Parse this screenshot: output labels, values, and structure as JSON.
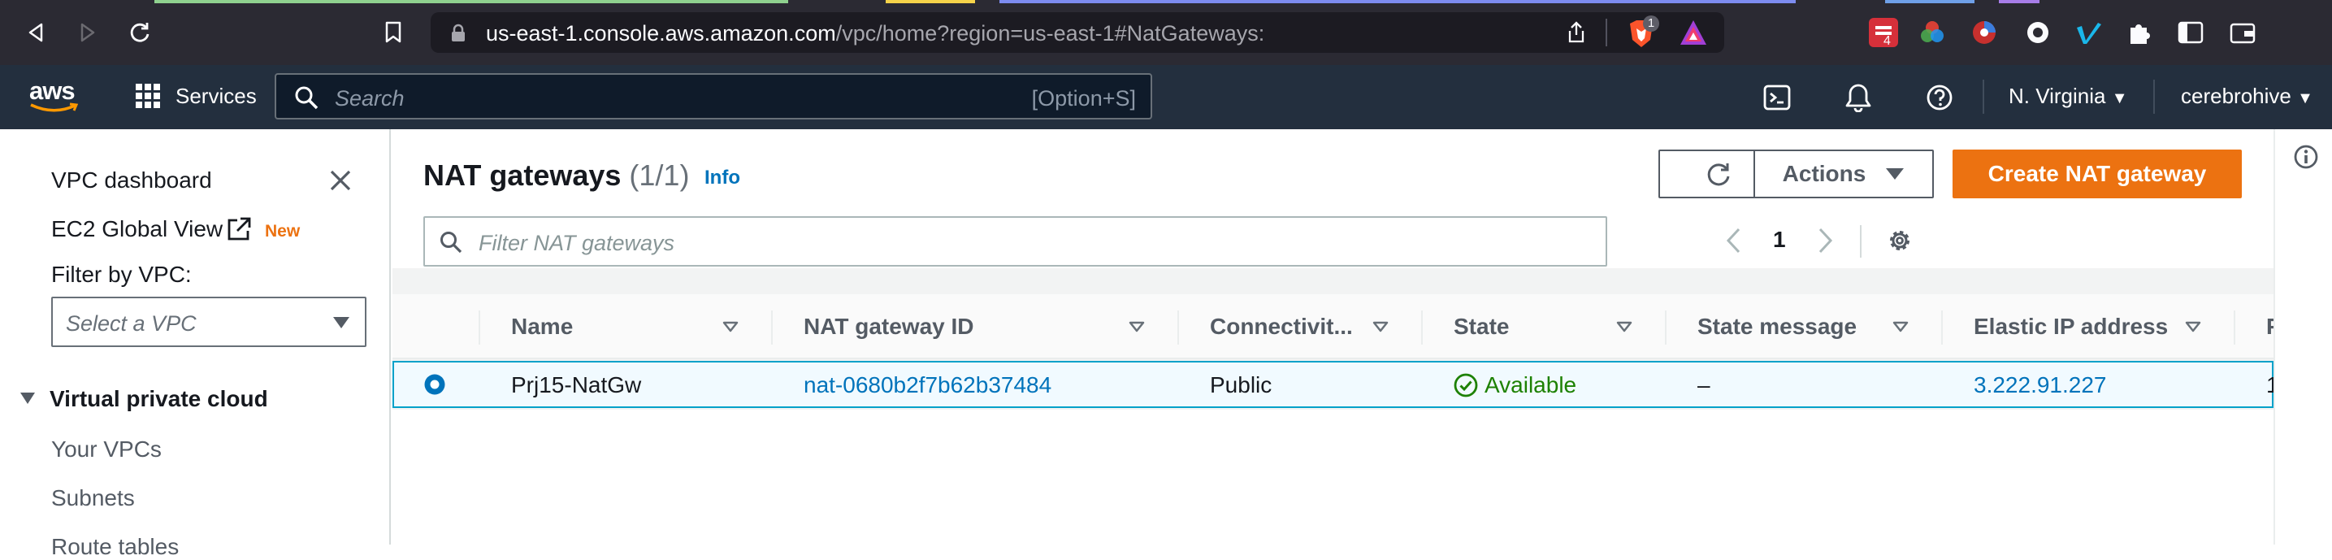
{
  "browser": {
    "url_host": "us-east-1.console.aws.amazon.com",
    "url_path": "/vpc/home?region=us-east-1#NatGateways:",
    "brave_badge": "1",
    "ext_badge": "4"
  },
  "aws_nav": {
    "logo": "aws",
    "services_label": "Services",
    "search_placeholder": "Search",
    "search_shortcut": "[Option+S]",
    "region": "N. Virginia",
    "account": "cerebrohive"
  },
  "sidebar": {
    "dashboard": "VPC dashboard",
    "global_view": "EC2 Global View",
    "new_badge": "New",
    "filter_label": "Filter by VPC:",
    "select_placeholder": "Select a VPC",
    "section": "Virtual private cloud",
    "items": [
      "Your VPCs",
      "Subnets",
      "Route tables"
    ]
  },
  "main": {
    "title": "NAT gateways",
    "count": "(1/1)",
    "info": "Info",
    "actions_label": "Actions",
    "create_label": "Create NAT gateway",
    "filter_placeholder": "Filter NAT gateways",
    "page_number": "1"
  },
  "table": {
    "columns": [
      "Name",
      "NAT gateway ID",
      "Connectivit...",
      "State",
      "State message",
      "Elastic IP address",
      "P"
    ],
    "rows": [
      {
        "name": "Prj15-NatGw",
        "id": "nat-0680b2f7b62b37484",
        "connectivity": "Public",
        "state": "Available",
        "state_message": "–",
        "elastic_ip": "3.222.91.227",
        "next_col": "1"
      }
    ]
  },
  "colors": {
    "aws_nav_bg": "#232f3e",
    "primary_orange": "#ec7211",
    "link_blue": "#0073bb",
    "success_green": "#1d8102",
    "selected_row_bg": "#f1faff"
  }
}
